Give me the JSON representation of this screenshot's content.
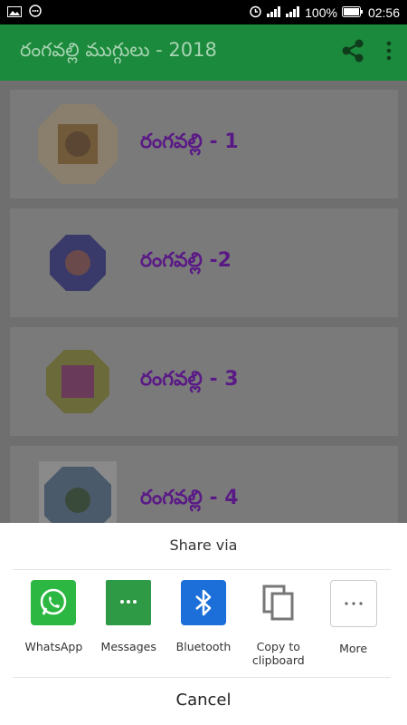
{
  "status_bar": {
    "battery": "100%",
    "time": "02:56"
  },
  "app_bar": {
    "title": "రంగవల్లి ముగ్గులు - 2018",
    "share_icon": "share-icon",
    "more_icon": "more-vert-icon",
    "bg": "#1b8a3c"
  },
  "list": {
    "items": [
      {
        "label": "రంగవల్లి - 1"
      },
      {
        "label": "రంగవల్లి -2"
      },
      {
        "label": "రంగవల్లి - 3"
      },
      {
        "label": "రంగవల్లి - 4"
      }
    ]
  },
  "share_sheet": {
    "title": "Share via",
    "options": [
      {
        "label": "WhatsApp",
        "icon": "whatsapp-icon",
        "color": "#2bb741"
      },
      {
        "label": "Messages",
        "icon": "messages-icon",
        "color": "#2f9a45"
      },
      {
        "label": "Bluetooth",
        "icon": "bluetooth-icon",
        "color": "#1c6fd8"
      },
      {
        "label": "Copy to\nclipboard",
        "icon": "copy-icon",
        "color": "#777777"
      },
      {
        "label": "More",
        "icon": "more-horiz-icon",
        "color": "#ffffff"
      }
    ],
    "cancel": "Cancel"
  }
}
